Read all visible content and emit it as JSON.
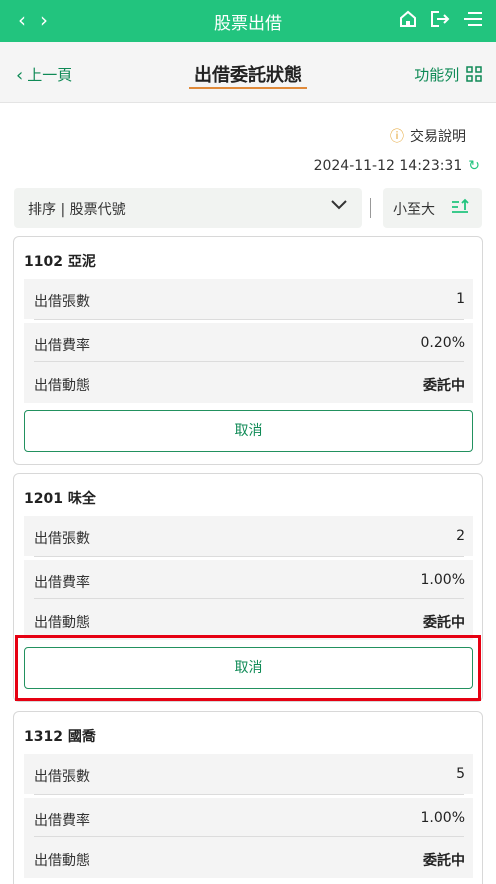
{
  "topbar": {
    "title": "股票出借"
  },
  "subbar": {
    "back_label": "上一頁",
    "page_title": "出借委託狀態",
    "func_label": "功能列"
  },
  "info": {
    "explain_label": "交易說明",
    "timestamp": "2024-11-12 14:23:31"
  },
  "sort": {
    "label": "排序 | 股票代號",
    "order_label": "小至大"
  },
  "colors": {
    "accent": "#22c47e",
    "button_border": "#22915f",
    "tab_underline": "#e08a3a",
    "highlight": "#e60012"
  },
  "cards": [
    {
      "name": "1102 亞泥",
      "rows": [
        {
          "label": "出借張數",
          "value": "1"
        },
        {
          "label": "出借費率",
          "value": "0.20%"
        },
        {
          "label": "出借動態",
          "value": "委託中"
        }
      ],
      "button": "取消"
    },
    {
      "name": "1201 味全",
      "rows": [
        {
          "label": "出借張數",
          "value": "2"
        },
        {
          "label": "出借費率",
          "value": "1.00%"
        },
        {
          "label": "出借動態",
          "value": "委託中"
        }
      ],
      "button": "取消"
    },
    {
      "name": "1312 國喬",
      "rows": [
        {
          "label": "出借張數",
          "value": "5"
        },
        {
          "label": "出借費率",
          "value": "1.00%"
        },
        {
          "label": "出借動態",
          "value": "委託中"
        }
      ]
    }
  ]
}
